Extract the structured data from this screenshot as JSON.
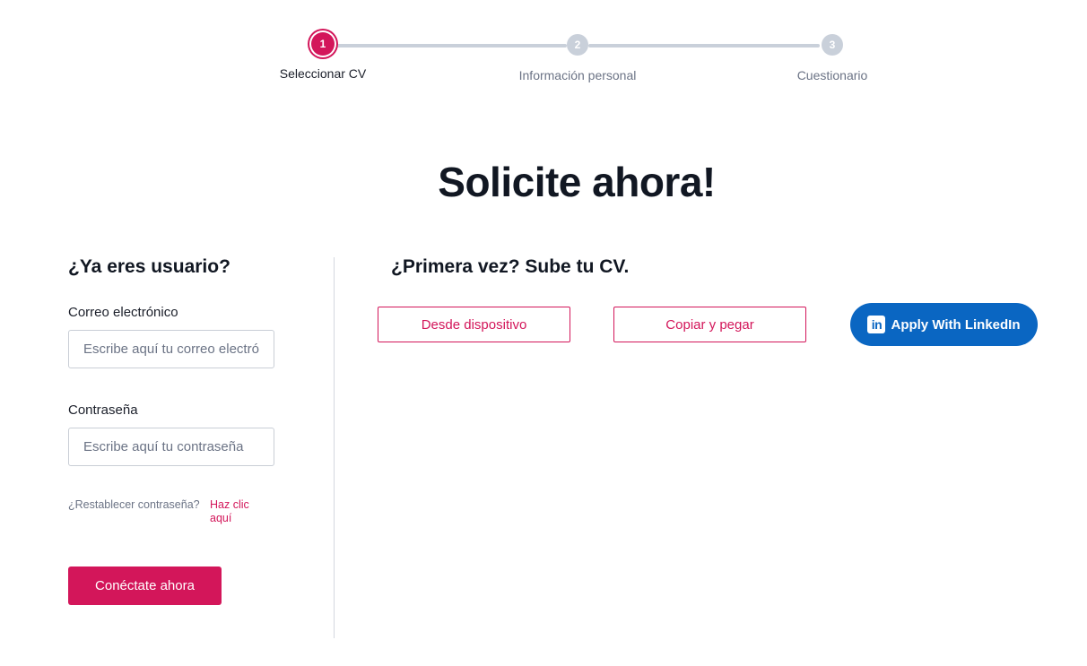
{
  "stepper": {
    "steps": [
      {
        "number": "1",
        "label": "Seleccionar CV"
      },
      {
        "number": "2",
        "label": "Información personal"
      },
      {
        "number": "3",
        "label": "Cuestionario"
      }
    ]
  },
  "page_title": "Solicite ahora!",
  "login": {
    "heading": "¿Ya eres usuario?",
    "email_label": "Correo electrónico",
    "email_placeholder": "Escribe aquí tu correo electrónico",
    "password_label": "Contraseña",
    "password_placeholder": "Escribe aquí tu contraseña",
    "reset_text": "¿Restablecer contraseña?",
    "reset_link": "Haz clic aquí",
    "submit_label": "Conéctate ahora"
  },
  "upload": {
    "heading": "¿Primera vez? Sube tu CV.",
    "device_label": "Desde dispositivo",
    "paste_label": "Copiar y pegar",
    "linkedin_label": "Apply With LinkedIn",
    "linkedin_icon": "in"
  },
  "colors": {
    "accent": "#d3165a",
    "linkedin": "#0a66c2",
    "inactive_step": "#c9d0da"
  }
}
